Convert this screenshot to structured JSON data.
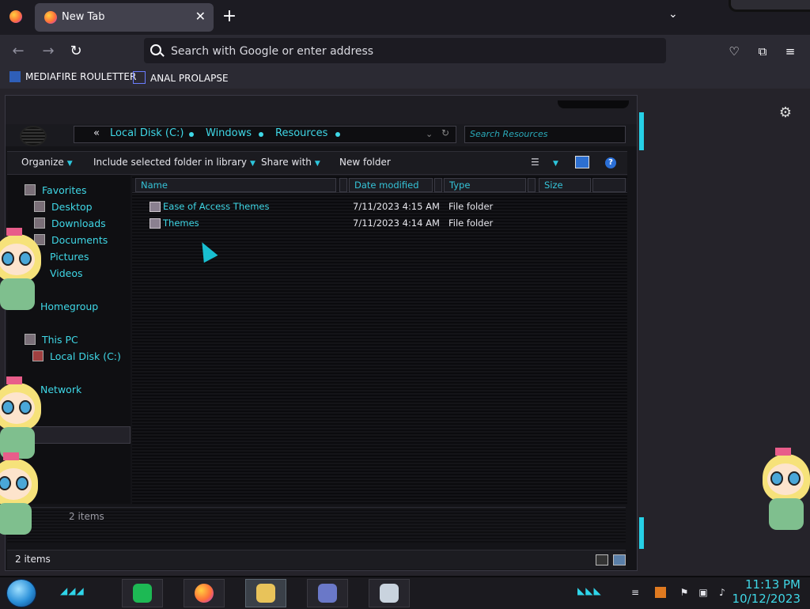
{
  "browser": {
    "tab_title": "New Tab",
    "url_placeholder": "Search with Google or enter address",
    "bookmarks": [
      {
        "label": "MEDIAFIRE ROULETTER"
      },
      {
        "label": "ANAL PROLAPSE"
      }
    ]
  },
  "explorer": {
    "breadcrumb": [
      "Local Disk (C:)",
      "Windows",
      "Resources"
    ],
    "breadcrumb_prefix": "«",
    "search_placeholder": "Search Resources",
    "commands": {
      "organize": "Organize",
      "include_library": "Include selected folder in library",
      "share_with": "Share with",
      "new_folder": "New folder"
    },
    "nav": {
      "favorites": "Favorites",
      "desktop": "Desktop",
      "downloads": "Downloads",
      "documents": "Documents",
      "pictures": "Pictures",
      "videos": "Videos",
      "homegroup": "Homegroup",
      "this_pc": "This PC",
      "local_disk": "Local Disk (C:)",
      "network": "Network"
    },
    "columns": {
      "name": "Name",
      "date_modified": "Date modified",
      "type": "Type",
      "size": "Size"
    },
    "files": [
      {
        "name": "Ease of Access Themes",
        "date": "7/11/2023 4:15 AM",
        "type": "File folder"
      },
      {
        "name": "Themes",
        "date": "7/11/2023 4:14 AM",
        "type": "File folder"
      }
    ],
    "details_count": "2 items",
    "status_text": "2 items"
  },
  "taskbar": {
    "time": "11:13 PM",
    "date": "10/12/2023",
    "apps": [
      "spotify-icon",
      "firefox-icon",
      "file-explorer-icon",
      "control-panel-icon",
      "resource-monitor-icon"
    ]
  },
  "colors": {
    "accent_cyan": "#3fd7e6",
    "browser_bg": "#2b2a33",
    "desktop_bg": "#25232a"
  }
}
